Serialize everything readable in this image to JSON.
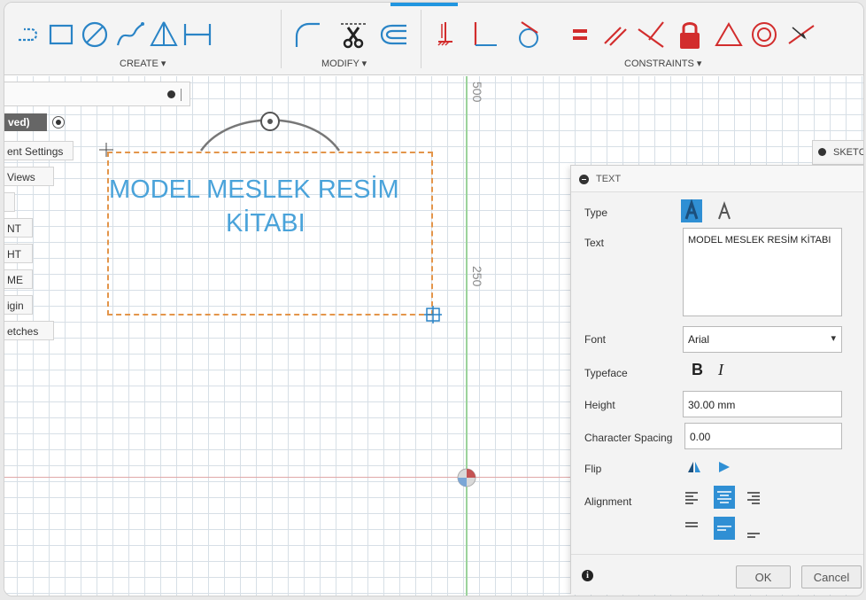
{
  "toolbar": {
    "groups": {
      "create": "CREATE ▾",
      "modify": "MODIFY ▾",
      "constraints": "CONSTRAINTS ▾"
    },
    "icons": [
      "offset-icon",
      "rectangle-icon",
      "circle-icon",
      "spline-icon",
      "triangle-mirror-icon",
      "dimension-icon",
      "fillet-icon",
      "scissors-icon",
      "offset-curve-icon",
      "fix-icon",
      "coincident-icon",
      "tangent-icon",
      "equal-icon",
      "parallel-icon",
      "perpendicular-icon",
      "lock-icon",
      "triangle-icon",
      "concentric-icon",
      "midpoint-icon"
    ],
    "accent_color": "#d22d2d",
    "active_color": "#2196e0"
  },
  "browser": {
    "unsaved_label": "ved)",
    "items": [
      "ent Settings",
      "Views",
      "",
      "NT",
      "HT",
      "ME",
      "igin",
      "etches"
    ]
  },
  "canvas": {
    "axis_labels": {
      "top": "500",
      "middle": "250"
    },
    "sketch_text": {
      "line1": "MODEL MESLEK RESİM",
      "line2": "KİTABI"
    },
    "text_color": "#4aa3da"
  },
  "palette_tab": {
    "label": "SKETC"
  },
  "text_dialog": {
    "title": "TEXT",
    "labels": {
      "type": "Type",
      "text": "Text",
      "font": "Font",
      "typeface": "Typeface",
      "height": "Height",
      "spacing": "Character Spacing",
      "flip": "Flip",
      "alignment": "Alignment"
    },
    "text_value": "MODEL MESLEK RESİM KİTABI",
    "font_value": "Arial",
    "height_value": "30.00 mm",
    "spacing_value": "0.00",
    "typeface_bold": "B",
    "typeface_italic": "I",
    "ok_label": "OK",
    "cancel_label": "Cancel"
  }
}
